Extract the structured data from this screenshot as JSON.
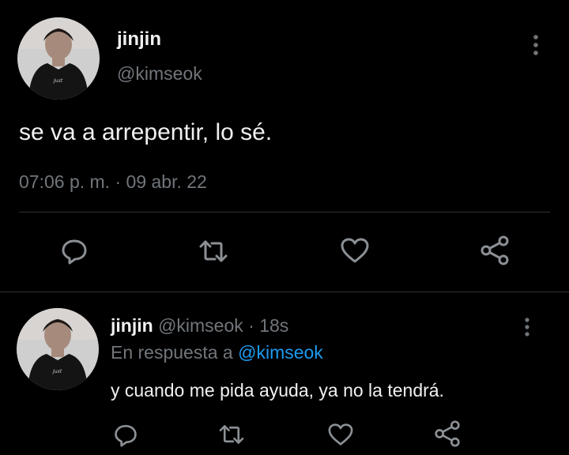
{
  "main_tweet": {
    "display_name": "jinjin",
    "handle": "@kimseok",
    "text": "se va a arrepentir, lo sé.",
    "time": "07:06 p. m.",
    "separator": "·",
    "date": "09 abr. 22",
    "avatar_text": "Just Listened"
  },
  "reply_tweet": {
    "display_name": "jinjin",
    "handle": "@kimseok",
    "separator": "·",
    "age": "18s",
    "reply_prefix": "En respuesta a",
    "reply_to": "@kimseok",
    "text": "y cuando me pida ayuda, ya no la tendrá.",
    "avatar_text": "Just Listened"
  },
  "actions": [
    "reply-icon",
    "retweet-icon",
    "like-icon",
    "share-icon"
  ],
  "colors": {
    "background": "#000000",
    "text": "#e7e9ea",
    "muted": "#71767b",
    "accent": "#1d9bf0",
    "divider": "#2f3336"
  }
}
